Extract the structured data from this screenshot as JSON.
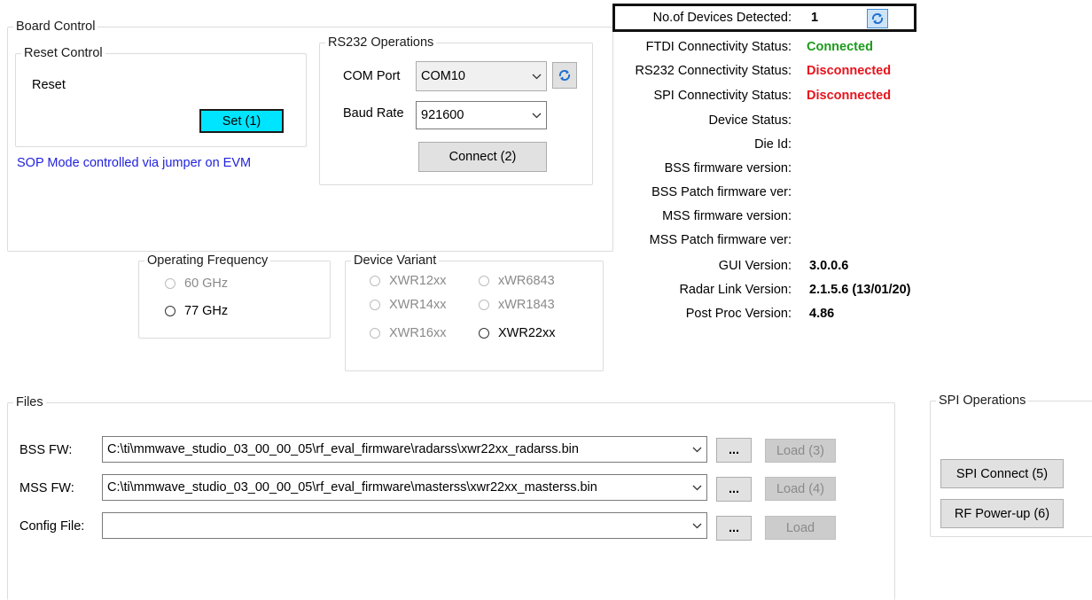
{
  "board_control": {
    "legend": "Board Control",
    "reset_control": {
      "legend": "Reset Control",
      "label": "Reset",
      "set_button": "Set (1)"
    },
    "sop_note": "SOP Mode controlled via jumper on EVM"
  },
  "rs232": {
    "legend": "RS232 Operations",
    "com_port_label": "COM Port",
    "com_port_value": "COM10",
    "baud_rate_label": "Baud Rate",
    "baud_rate_value": "921600",
    "connect_button": "Connect (2)"
  },
  "status": {
    "devices_detected_label": "No.of Devices Detected:",
    "devices_detected_value": "1",
    "ftdi_label": "FTDI Connectivity Status:",
    "ftdi_value": "Connected",
    "rs232_label": "RS232 Connectivity Status:",
    "rs232_value": "Disconnected",
    "spi_label": "SPI Connectivity Status:",
    "spi_value": "Disconnected",
    "device_status_label": "Device Status:",
    "die_id_label": "Die Id:",
    "bss_fw_label": "BSS firmware version:",
    "bss_patch_label": "BSS Patch firmware ver:",
    "mss_fw_label": "MSS firmware version:",
    "mss_patch_label": "MSS Patch firmware ver:",
    "gui_version_label": "GUI Version:",
    "gui_version_value": "3.0.0.6",
    "radar_link_label": "Radar Link Version:",
    "radar_link_value": "2.1.5.6 (13/01/20)",
    "post_proc_label": "Post Proc Version:",
    "post_proc_value": "4.86",
    "colors": {
      "connected": "#1a9b1a",
      "disconnected": "#e8121b"
    }
  },
  "operating_frequency": {
    "legend": "Operating Frequency",
    "options": [
      "60 GHz",
      "77 GHz"
    ]
  },
  "device_variant": {
    "legend": "Device Variant",
    "options": [
      "XWR12xx",
      "xWR6843",
      "XWR14xx",
      "xWR1843",
      "XWR16xx",
      "XWR22xx"
    ]
  },
  "files": {
    "legend": "Files",
    "bss_label": "BSS FW:",
    "bss_path": "C:\\ti\\mmwave_studio_03_00_00_05\\rf_eval_firmware\\radarss\\xwr22xx_radarss.bin",
    "bss_load": "Load (3)",
    "mss_label": "MSS FW:",
    "mss_path": "C:\\ti\\mmwave_studio_03_00_00_05\\rf_eval_firmware\\masterss\\xwr22xx_masterss.bin",
    "mss_load": "Load (4)",
    "config_label": "Config File:",
    "config_path": "",
    "config_load": "Load",
    "browse": "..."
  },
  "spi": {
    "legend": "SPI Operations",
    "connect_button": "SPI Connect (5)",
    "power_button": "RF Power-up (6)"
  }
}
